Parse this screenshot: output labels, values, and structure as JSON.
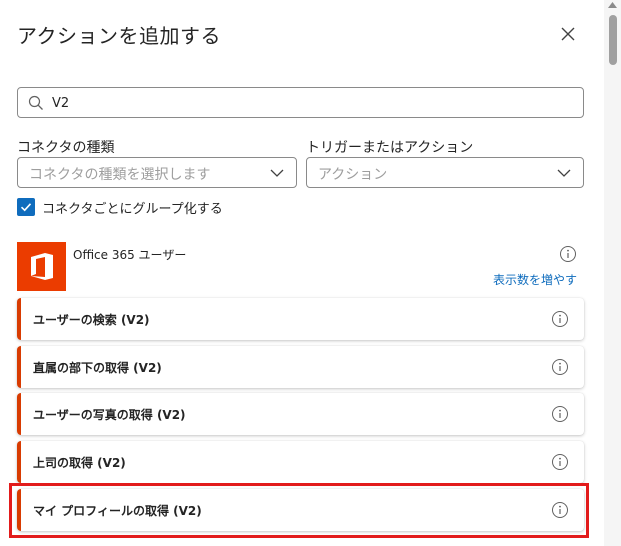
{
  "dialog": {
    "title": "アクションを追加する",
    "close_icon": "close-icon"
  },
  "search": {
    "value": "V2",
    "icon": "search-icon"
  },
  "filters": {
    "connector_type": {
      "label": "コネクタの種類",
      "placeholder": "コネクタの種類を選択します"
    },
    "trigger_or_action": {
      "label": "トリガーまたはアクション",
      "placeholder": "アクション"
    },
    "group_by_connector": {
      "label": "コネクタごとにグループ化する",
      "checked": true
    }
  },
  "connector": {
    "name": "Office 365 ユーザー",
    "show_more": "表示数を増やす",
    "brand_color": "#eb3c00",
    "logo_icon": "office-logo-icon",
    "actions": [
      {
        "label": "ユーザーの検索 (V2)"
      },
      {
        "label": "直属の部下の取得 (V2)"
      },
      {
        "label": "ユーザーの写真の取得 (V2)"
      },
      {
        "label": "上司の取得 (V2)"
      },
      {
        "label": "マイ プロフィールの取得 (V2)"
      }
    ]
  },
  "colors": {
    "accent": "#0f6cbd",
    "action_accent": "#d83b01",
    "highlight": "#e21b1b"
  }
}
